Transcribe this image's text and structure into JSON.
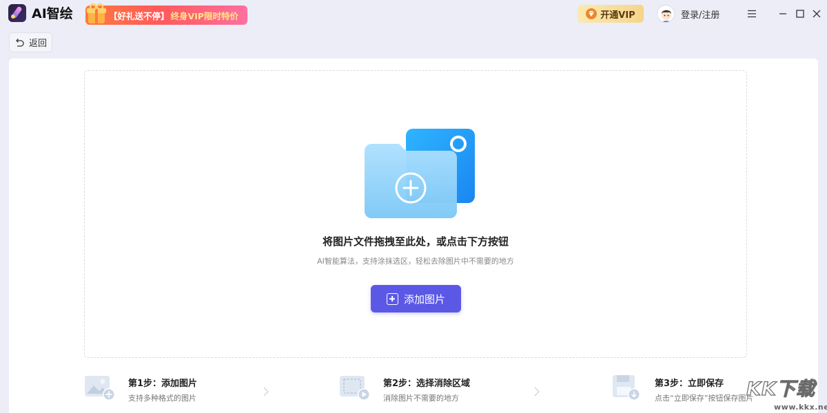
{
  "app": {
    "title": "AI智绘"
  },
  "promo": {
    "text_a": "【好礼送不停】",
    "text_b": "终身VIP限时特价"
  },
  "header": {
    "vip_label": "开通VIP",
    "login_label": "登录/注册"
  },
  "toolbar": {
    "back_label": "返回"
  },
  "dropzone": {
    "title": "将图片文件拖拽至此处，或点击下方按钮",
    "subtitle": "AI智能算法，支持涂抹选区，轻松去除图片中不需要的地方",
    "add_button_label": "添加图片"
  },
  "steps": [
    {
      "title": "第1步：添加图片",
      "desc": "支持多种格式的图片"
    },
    {
      "title": "第2步：选择消除区域",
      "desc": "消除图片不需要的地方"
    },
    {
      "title": "第3步：立即保存",
      "desc": "点击“立即保存”按钮保存图片"
    }
  ],
  "watermark": {
    "big": "KK下载",
    "small": "www.kkx.net"
  },
  "colors": {
    "accent": "#5b58e6",
    "background": "#ecedf7",
    "vip_gold": "#f6d58a",
    "promo_red": "#ff5a5a"
  },
  "icons": {
    "menu": "hamburger-menu-icon",
    "minimize": "minimize-icon",
    "maximize": "maximize-icon",
    "close": "close-icon",
    "back": "undo-arrow-icon"
  }
}
